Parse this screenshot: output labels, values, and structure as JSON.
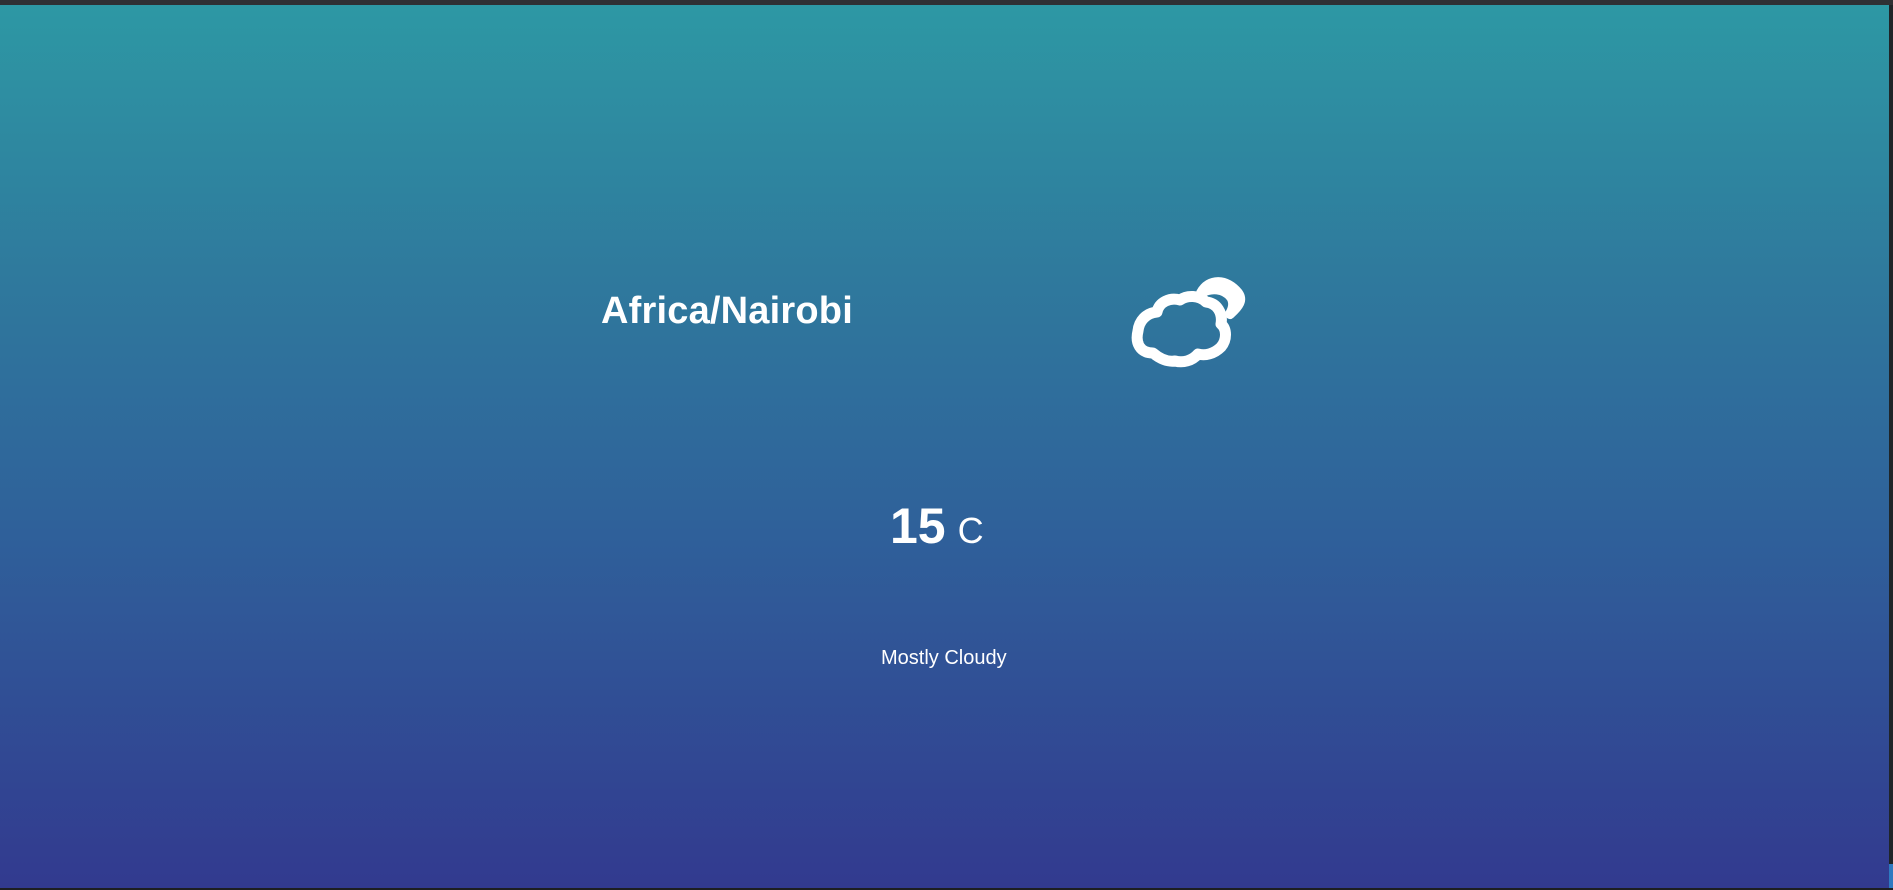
{
  "weather": {
    "timezone": "Africa/Nairobi",
    "temperature": "15",
    "unit": "C",
    "summary": "Mostly Cloudy",
    "icon": "partly-cloudy-night-icon"
  },
  "colors": {
    "gradient_top": "#2d98a4",
    "gradient_bottom": "#323a8f",
    "text": "#ffffff"
  }
}
